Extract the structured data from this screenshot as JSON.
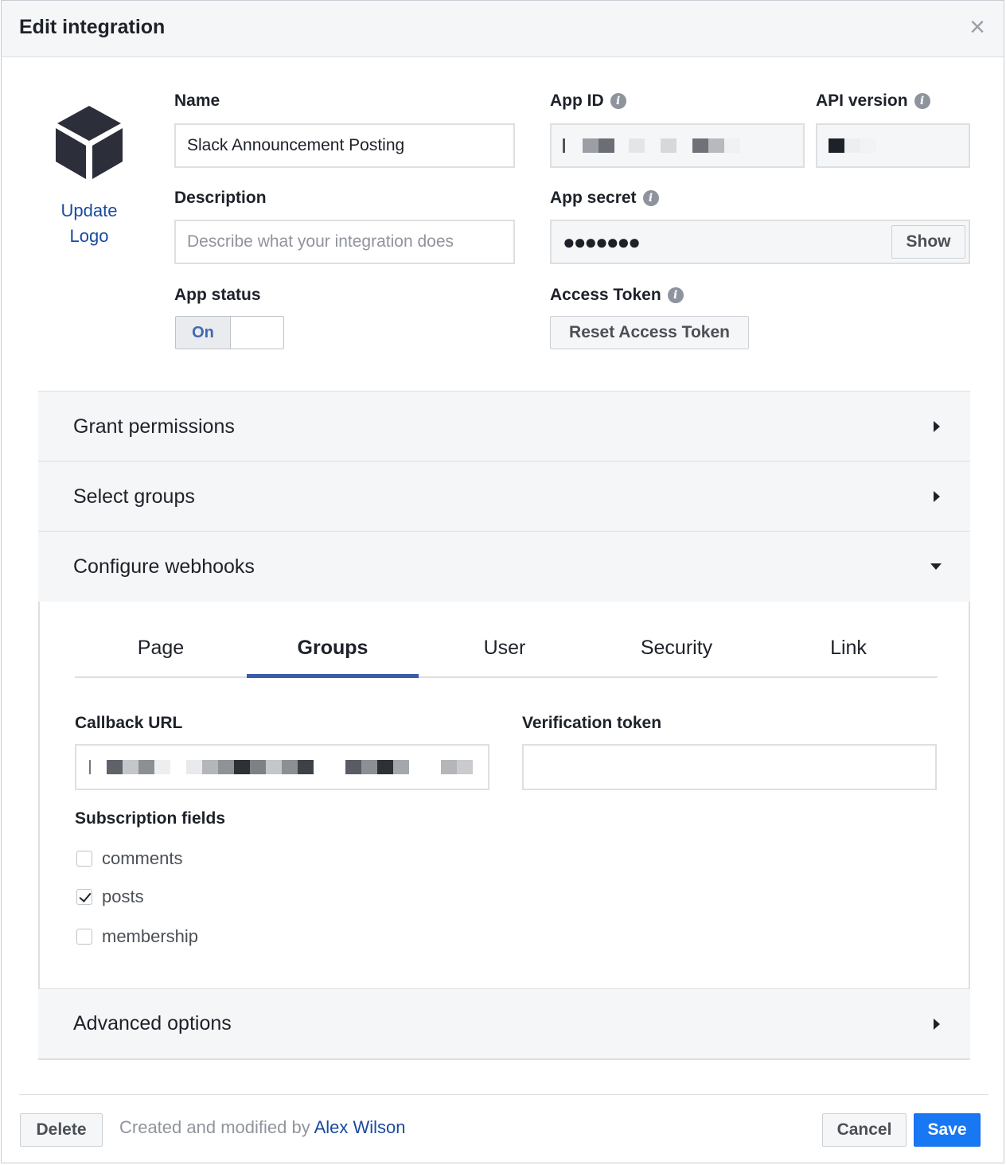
{
  "dialog": {
    "title": "Edit integration",
    "close_icon": "close-icon"
  },
  "logo": {
    "icon": "cube-icon",
    "update_label_line1": "Update",
    "update_label_line2": "Logo"
  },
  "fields": {
    "name": {
      "label": "Name",
      "value": "Slack Announcement Posting"
    },
    "description": {
      "label": "Description",
      "placeholder": "Describe what your integration does",
      "value": ""
    },
    "app_status": {
      "label": "App status",
      "toggle_label": "On",
      "enabled": true
    },
    "app_id": {
      "label": "App ID",
      "value_obscured": true
    },
    "api_version": {
      "label": "API version",
      "value_obscured": true
    },
    "app_secret": {
      "label": "App secret",
      "masked_value": "●●●●●●●",
      "show_label": "Show"
    },
    "access_token": {
      "label": "Access Token",
      "reset_label": "Reset Access Token"
    }
  },
  "sections": {
    "grant_permissions": {
      "title": "Grant permissions",
      "expanded": false
    },
    "select_groups": {
      "title": "Select groups",
      "expanded": false
    },
    "configure_webhooks": {
      "title": "Configure webhooks",
      "expanded": true
    },
    "advanced_options": {
      "title": "Advanced options",
      "expanded": false
    }
  },
  "webhooks": {
    "tabs": [
      "Page",
      "Groups",
      "User",
      "Security",
      "Link"
    ],
    "active_tab": "Groups",
    "callback_url": {
      "label": "Callback URL",
      "value_obscured": true
    },
    "verification_token": {
      "label": "Verification token",
      "value": ""
    },
    "subscription_fields": {
      "label": "Subscription fields",
      "items": [
        {
          "label": "comments",
          "checked": false
        },
        {
          "label": "posts",
          "checked": true
        },
        {
          "label": "membership",
          "checked": false
        }
      ]
    }
  },
  "footer": {
    "delete_label": "Delete",
    "created_text": "Created and modified by ",
    "author": "Alex Wilson",
    "cancel_label": "Cancel",
    "save_label": "Save"
  },
  "colors": {
    "primary": "#1877f2",
    "link": "#1a4aa0",
    "tab_underline": "#3b5aa8",
    "toggle_on_text": "#4267b2"
  }
}
